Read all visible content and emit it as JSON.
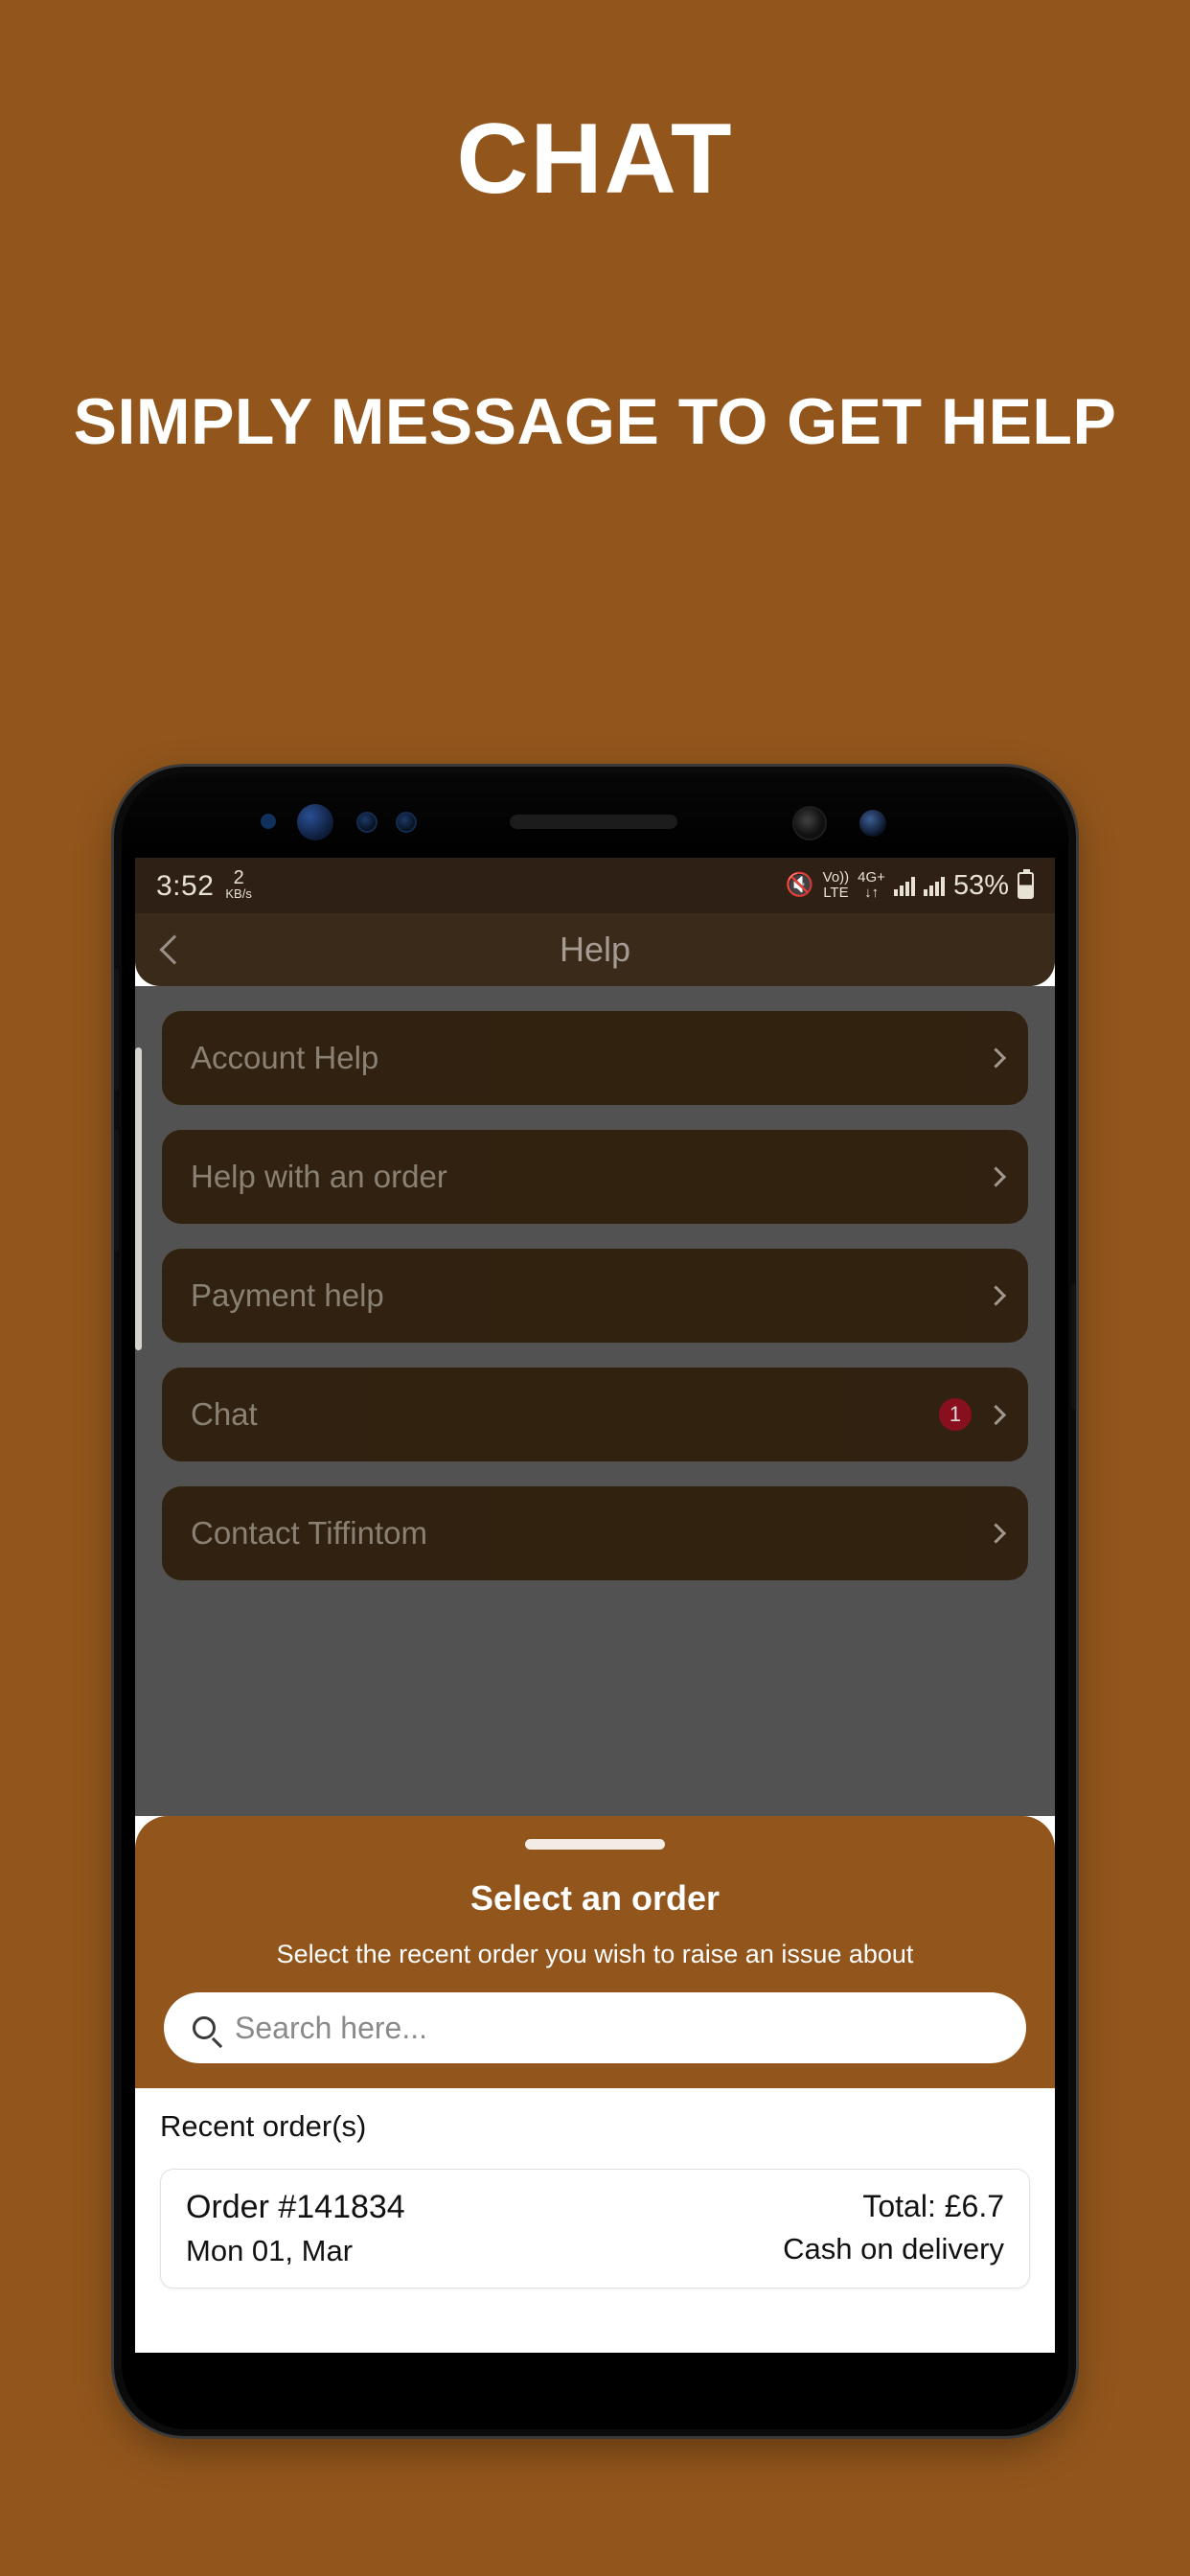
{
  "promo": {
    "title": "CHAT",
    "subtitle": "SIMPLY MESSAGE TO GET HELP",
    "background_color": "#92561C"
  },
  "status_bar": {
    "time": "3:52",
    "net_speed_value": "2",
    "net_speed_unit": "KB/s",
    "mute_icon": "mute-icon",
    "volte_top": "Vo))",
    "volte_bottom": "LTE",
    "network_type": "4G+",
    "data_arrows": "↓↑",
    "battery_percent": "53%"
  },
  "app_bar": {
    "back_icon": "chevron-left-icon",
    "title": "Help"
  },
  "help_menu": {
    "items": [
      {
        "label": "Account Help",
        "badge": ""
      },
      {
        "label": "Help with an order",
        "badge": ""
      },
      {
        "label": "Payment help",
        "badge": ""
      },
      {
        "label": "Chat",
        "badge": "1"
      },
      {
        "label": "Contact Tiffintom",
        "badge": ""
      }
    ],
    "chevron_icon": "chevron-right-icon",
    "badge_color": "#8b0e1c",
    "row_color": "#30200E",
    "dim_overlay_color": "#525252"
  },
  "bottom_sheet": {
    "grabber": "drag-handle",
    "title": "Select an order",
    "subtitle": "Select the recent order you wish to raise an issue about",
    "search": {
      "icon": "search-icon",
      "placeholder": "Search here...",
      "value": ""
    },
    "background_color": "#92561C"
  },
  "orders": {
    "section_title": "Recent order(s)",
    "list": [
      {
        "order_id": "Order #141834",
        "date": "Mon 01, Mar",
        "total": "Total: £6.7",
        "payment": "Cash on delivery"
      }
    ]
  }
}
